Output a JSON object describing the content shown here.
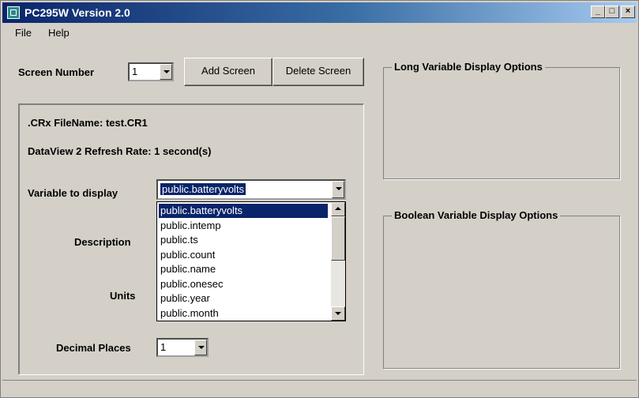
{
  "window": {
    "title": "PC295W Version 2.0",
    "controls": {
      "minimize": "_",
      "maximize": "□",
      "close": "×"
    }
  },
  "menu": [
    {
      "label": "File"
    },
    {
      "label": "Help"
    }
  ],
  "screen": {
    "label": "Screen Number",
    "value": "1",
    "add_button": "Add Screen",
    "delete_button": "Delete Screen"
  },
  "config": {
    "filename": ".CRx FileName: test.CR1",
    "refresh": "DataView 2 Refresh Rate: 1 second(s)",
    "variable_label": "Variable to display",
    "variable_value": "public.batteryvolts",
    "description_label": "Description",
    "units_label": "Units",
    "decimal_label": "Decimal Places",
    "decimal_value": "1"
  },
  "dropdown_options": [
    "public.batteryvolts",
    "public.intemp",
    "public.ts",
    "public.count",
    "public.name",
    "public.onesec",
    "public.year",
    "public.month"
  ],
  "groups": {
    "long_title": "Long Variable Display Options",
    "boolean_title": "Boolean Variable Display Options"
  },
  "colors": {
    "title_start": "#0a246a",
    "title_end": "#a6caf0",
    "selection": "#0a246a"
  }
}
